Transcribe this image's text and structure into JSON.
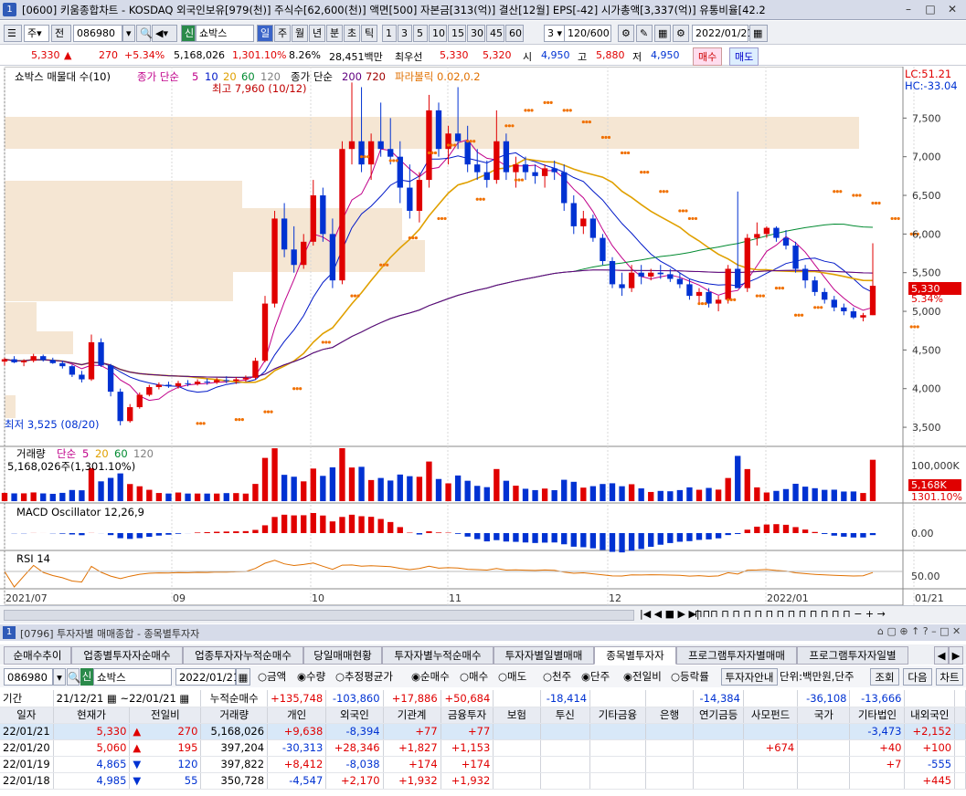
{
  "window": {
    "title": "[0600] 키움종합차트 - KOSDAQ 외국인보유[979(천)] 주식수[62,600(천)] 액면[500] 자본금[313(억)] 결산[12월] EPS[-42] 시가총액[3,337(억)] 유통비율[42.2"
  },
  "toolbar": {
    "period": "주",
    "prev": "전",
    "code": "086980",
    "name": "쇼박스",
    "shin": "신",
    "periods": [
      "일",
      "주",
      "월",
      "년",
      "분",
      "초",
      "틱"
    ],
    "nums": [
      "1",
      "3",
      "5",
      "10",
      "15",
      "30",
      "45",
      "60"
    ],
    "sel": "3",
    "count": "120/600",
    "date": "2022/01/21"
  },
  "quote": {
    "price": "5,330",
    "arrow": "▲",
    "change": "270",
    "pct": "+5.34%",
    "volume": "5,168,026",
    "vol_pct": "1,301.10%",
    "turnover": "8.26%",
    "amount": "28,451백만",
    "best": "최우선",
    "best_ask": "5,330",
    "best_bid": "5,320",
    "open_l": "시",
    "open": "4,950",
    "high_l": "고",
    "high": "5,880",
    "low_l": "저",
    "low": "4,950",
    "buy": "매수",
    "sell": "매도"
  },
  "chart_data": {
    "type": "candlestick",
    "legend": {
      "name": "쇼박스 매물대 수(10)",
      "ma_label": "종가 단순",
      "ma1": "5",
      "ma2": "10",
      "ma3": "20",
      "ma4": "60",
      "ma5": "120",
      "ma_label2": "종가 단순",
      "ma6": "200",
      "ma7": "720",
      "sar": "파라볼릭 0.02,0.2"
    },
    "high_note": "최고 7,960 (10/12)",
    "low_note": "최저 3,525 (08/20)",
    "lc": "LC:51.21",
    "hc": "HC:-33.04",
    "y_ticks": [
      "7,500",
      "7,000",
      "6,500",
      "6,000",
      "5,500",
      "5,000",
      "4,500",
      "4,000",
      "3,500"
    ],
    "y_range": [
      3300,
      8000
    ],
    "price_tag": "5,330",
    "pct_tag": "5.34%",
    "x_ticks": [
      "2021/07",
      "09",
      "10",
      "11",
      "12",
      "2022/01",
      "01/21"
    ],
    "volume": {
      "label": "거래량",
      "ma": "단순",
      "m1": "5",
      "m2": "20",
      "m3": "60",
      "m4": "120",
      "current": "5,168,026주(1,301.10%)",
      "tick": "100,000K",
      "tag": "5,168K",
      "tag2": "1301.10%"
    },
    "macd": {
      "label": "MACD Oscillator 12,26,9",
      "tick": "0.00"
    },
    "rsi": {
      "label": "RSI 14",
      "tick": "50.00"
    },
    "candles": [
      [
        4350,
        4400,
        4300,
        4380
      ],
      [
        4380,
        4420,
        4330,
        4340
      ],
      [
        4340,
        4380,
        4290,
        4360
      ],
      [
        4360,
        4450,
        4340,
        4420
      ],
      [
        4420,
        4440,
        4350,
        4370
      ],
      [
        4370,
        4400,
        4320,
        4330
      ],
      [
        4330,
        4360,
        4260,
        4290
      ],
      [
        4290,
        4310,
        4150,
        4180
      ],
      [
        4180,
        4230,
        4080,
        4120
      ],
      [
        4120,
        4700,
        4100,
        4600
      ],
      [
        4600,
        4650,
        4280,
        4300
      ],
      [
        4300,
        4320,
        3900,
        3960
      ],
      [
        3960,
        4000,
        3525,
        3580
      ],
      [
        3580,
        3800,
        3560,
        3760
      ],
      [
        3760,
        3950,
        3740,
        3920
      ],
      [
        3920,
        4050,
        3900,
        4020
      ],
      [
        4020,
        4080,
        3990,
        4050
      ],
      [
        4050,
        4090,
        4010,
        4030
      ],
      [
        4030,
        4100,
        4000,
        4070
      ],
      [
        4070,
        4110,
        4030,
        4060
      ],
      [
        4060,
        4120,
        4040,
        4090
      ],
      [
        4090,
        4130,
        4050,
        4080
      ],
      [
        4080,
        4140,
        4060,
        4110
      ],
      [
        4110,
        4160,
        4070,
        4100
      ],
      [
        4100,
        4150,
        4060,
        4120
      ],
      [
        4120,
        4170,
        4090,
        4140
      ],
      [
        4140,
        4400,
        4120,
        4360
      ],
      [
        4360,
        5200,
        4340,
        5100
      ],
      [
        5100,
        6300,
        5050,
        6200
      ],
      [
        6200,
        6400,
        5700,
        5800
      ],
      [
        5800,
        6100,
        5500,
        5600
      ],
      [
        5600,
        6000,
        5550,
        5900
      ],
      [
        5900,
        6700,
        5850,
        6500
      ],
      [
        6500,
        6600,
        5900,
        6000
      ],
      [
        6000,
        6200,
        5300,
        5400
      ],
      [
        5400,
        7200,
        5350,
        7100
      ],
      [
        7100,
        7960,
        6900,
        7200
      ],
      [
        7200,
        7900,
        6800,
        6900
      ],
      [
        6900,
        7300,
        6700,
        7200
      ],
      [
        7200,
        7700,
        7000,
        7100
      ],
      [
        7100,
        7500,
        6900,
        7000
      ],
      [
        7000,
        7200,
        6400,
        6600
      ],
      [
        6600,
        6900,
        6200,
        6300
      ],
      [
        6300,
        6800,
        6150,
        6700
      ],
      [
        6700,
        7800,
        6600,
        7600
      ],
      [
        7600,
        7700,
        7000,
        7100
      ],
      [
        7100,
        7400,
        6900,
        7300
      ],
      [
        7300,
        7900,
        7100,
        7200
      ],
      [
        7200,
        7400,
        6800,
        6900
      ],
      [
        6900,
        7100,
        6700,
        6800
      ],
      [
        6800,
        6950,
        6600,
        6700
      ],
      [
        6700,
        7600,
        6650,
        7200
      ],
      [
        7200,
        7300,
        6700,
        6800
      ],
      [
        6800,
        7000,
        6600,
        6900
      ],
      [
        6900,
        7000,
        6700,
        6800
      ],
      [
        6800,
        6900,
        6650,
        6750
      ],
      [
        6750,
        6900,
        6600,
        6850
      ],
      [
        6850,
        6950,
        6700,
        6800
      ],
      [
        6800,
        6900,
        6300,
        6400
      ],
      [
        6400,
        6500,
        6000,
        6100
      ],
      [
        6100,
        6300,
        6000,
        6200
      ],
      [
        6200,
        6250,
        5900,
        5950
      ],
      [
        5950,
        6000,
        5600,
        5650
      ],
      [
        5650,
        5700,
        5300,
        5350
      ],
      [
        5350,
        5500,
        5200,
        5300
      ],
      [
        5300,
        5600,
        5250,
        5500
      ],
      [
        5500,
        5600,
        5350,
        5450
      ],
      [
        5450,
        5550,
        5400,
        5500
      ],
      [
        5500,
        5600,
        5420,
        5480
      ],
      [
        5480,
        5550,
        5380,
        5420
      ],
      [
        5420,
        5500,
        5300,
        5350
      ],
      [
        5350,
        5420,
        5150,
        5200
      ],
      [
        5200,
        5300,
        5100,
        5250
      ],
      [
        5250,
        5300,
        5050,
        5100
      ],
      [
        5100,
        5200,
        5000,
        5150
      ],
      [
        5150,
        5600,
        5100,
        5550
      ],
      [
        5550,
        6550,
        5400,
        5300
      ],
      [
        5300,
        6000,
        5250,
        5950
      ],
      [
        5950,
        6150,
        5850,
        6000
      ],
      [
        6000,
        6100,
        5950,
        6080
      ],
      [
        6080,
        6100,
        5900,
        5950
      ],
      [
        5950,
        6050,
        5800,
        5850
      ],
      [
        5850,
        5900,
        5500,
        5550
      ],
      [
        5550,
        5600,
        5300,
        5400
      ],
      [
        5400,
        5450,
        5200,
        5250
      ],
      [
        5250,
        5300,
        5100,
        5150
      ],
      [
        5150,
        5200,
        5000,
        5050
      ],
      [
        5050,
        5100,
        4950,
        5000
      ],
      [
        5000,
        5050,
        4900,
        4920
      ],
      [
        4920,
        4980,
        4870,
        4950
      ],
      [
        4950,
        5880,
        4950,
        5330
      ]
    ],
    "sar_top": [
      [
        37,
        7000
      ],
      [
        40,
        6950
      ],
      [
        44,
        7050
      ],
      [
        46,
        7150
      ],
      [
        48,
        7200
      ],
      [
        52,
        7400
      ],
      [
        54,
        7600
      ],
      [
        56,
        7700
      ],
      [
        58,
        7600
      ],
      [
        60,
        7450
      ],
      [
        62,
        7250
      ],
      [
        64,
        7050
      ],
      [
        66,
        6800
      ],
      [
        68,
        6550
      ],
      [
        70,
        6300
      ],
      [
        71,
        6200
      ],
      [
        86,
        6550
      ],
      [
        88,
        6500
      ],
      [
        90,
        6400
      ],
      [
        92,
        6200
      ],
      [
        94,
        6000
      ]
    ],
    "sar_bot": [
      [
        20,
        3550
      ],
      [
        24,
        3600
      ],
      [
        27,
        3700
      ],
      [
        30,
        4000
      ],
      [
        33,
        4600
      ],
      [
        36,
        5200
      ],
      [
        39,
        5600
      ],
      [
        42,
        5950
      ],
      [
        45,
        6200
      ],
      [
        49,
        6450
      ],
      [
        53,
        6700
      ],
      [
        72,
        5100
      ],
      [
        75,
        5150
      ],
      [
        78,
        5200
      ],
      [
        80,
        5300
      ],
      [
        82,
        4950
      ],
      [
        84,
        5050
      ],
      [
        94,
        4800
      ]
    ]
  },
  "subwin": {
    "title": "[0796] 투자자별 매매종합 - 종목별투자자"
  },
  "tabs": [
    "순매수추이",
    "업종별투자자순매수",
    "업종투자자누적순매수",
    "당일매매현황",
    "투자자별누적순매수",
    "투자자별일별매매",
    "종목별투자자",
    "프로그램투자자별매매",
    "프로그램투자자일별"
  ],
  "controls": {
    "code": "086980",
    "shin": "신",
    "name": "쇼박스",
    "date": "2022/01/21",
    "r1": "금액",
    "r2": "수량",
    "r3": "추정평균가",
    "r4": "순매수",
    "r5": "매수",
    "r6": "매도",
    "r7": "천주",
    "r8": "단주",
    "r9": "전일비",
    "r10": "등락률",
    "guide": "투자자안내",
    "unit": "단위:백만원,단주",
    "query": "조회",
    "next": "다음",
    "chart": "차트"
  },
  "period": {
    "label": "기간",
    "from": "21/12/21",
    "to": "22/01/21",
    "acc": "누적순매수",
    "sums": [
      "+135,748",
      "-103,860",
      "+17,886",
      "+50,684",
      "",
      "-18,414",
      "",
      "",
      "-14,384",
      "",
      "-36,108",
      "-13,666"
    ]
  },
  "table": {
    "headers": [
      "일자",
      "현재가",
      "전일비",
      "거래량",
      "개인",
      "외국인",
      "기관계",
      "금융투자",
      "보험",
      "투신",
      "기타금융",
      "은행",
      "연기금등",
      "사모펀드",
      "국가",
      "기타법인",
      "내외국인"
    ],
    "rows": [
      [
        "22/01/21",
        "5,330",
        "▲",
        "270",
        "5,168,026",
        "+9,638",
        "-8,394",
        "+77",
        "+77",
        "",
        "",
        "",
        "",
        "",
        "",
        "",
        "-3,473",
        "+2,152"
      ],
      [
        "22/01/20",
        "5,060",
        "▲",
        "195",
        "397,204",
        "-30,313",
        "+28,346",
        "+1,827",
        "+1,153",
        "",
        "",
        "",
        "",
        "",
        "+674",
        "",
        "+40",
        "+100"
      ],
      [
        "22/01/19",
        "4,865",
        "▼",
        "120",
        "397,822",
        "+8,412",
        "-8,038",
        "+174",
        "+174",
        "",
        "",
        "",
        "",
        "",
        "",
        "",
        "+7",
        "-555"
      ],
      [
        "22/01/18",
        "4,985",
        "▼",
        "55",
        "350,728",
        "-4,547",
        "+2,170",
        "+1,932",
        "+1,932",
        "",
        "",
        "",
        "",
        "",
        "",
        "",
        "",
        "+445"
      ]
    ]
  }
}
